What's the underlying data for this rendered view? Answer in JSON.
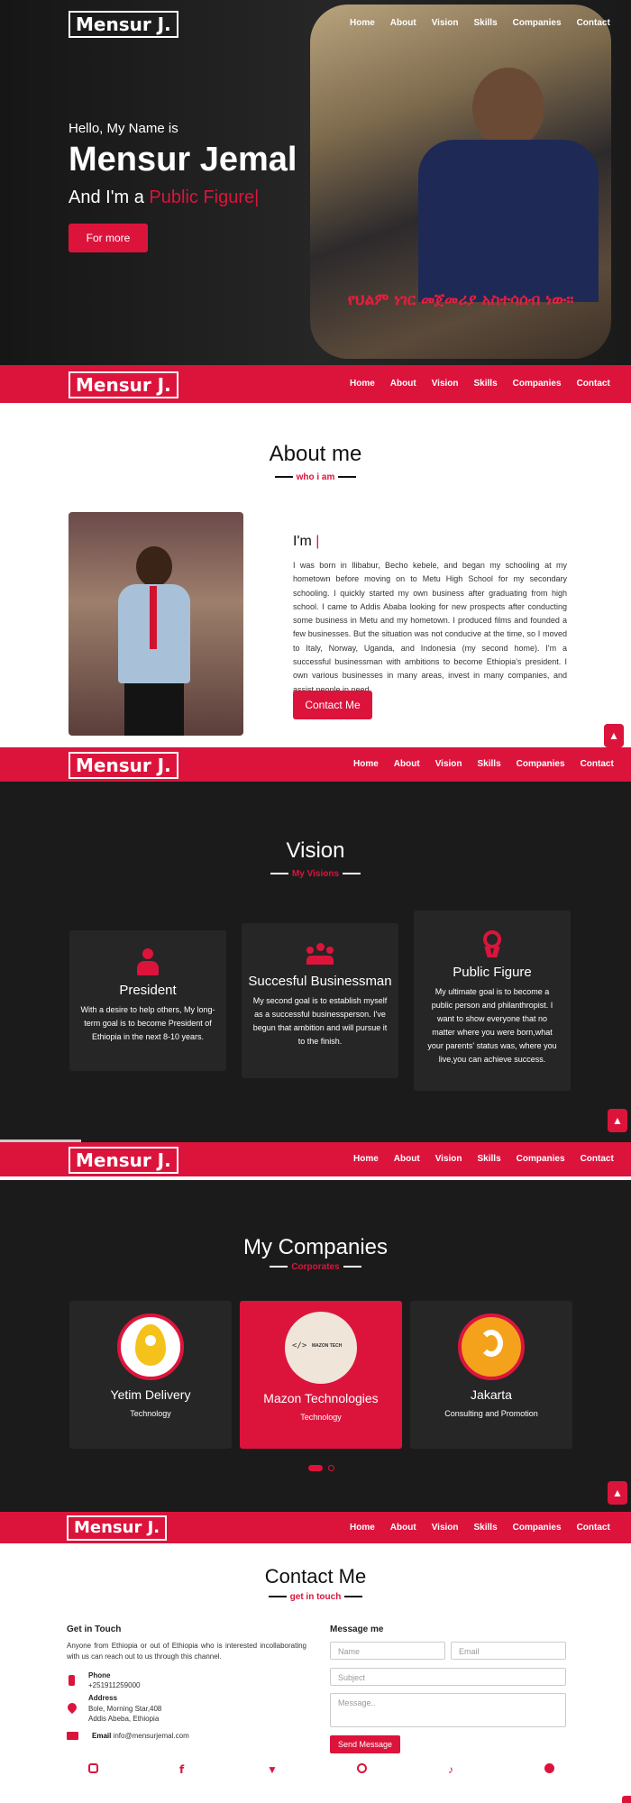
{
  "brand": "Mensur J.",
  "nav": [
    "Home",
    "About",
    "Vision",
    "Skills",
    "Companies",
    "Contact"
  ],
  "hero": {
    "greeting": "Hello, My Name is",
    "name": "Mensur Jemal",
    "prefix": "And I'm a ",
    "role": "Public Figure|",
    "button": "For more",
    "amharic": "የህልም ነገር መጀመሪያ አስተሳሰብ ነው።"
  },
  "about": {
    "title": "About me",
    "subtitle": "who i am",
    "im": "I'm",
    "cursor": "|",
    "body": "I was born in Ilibabur, Becho kebele, and began my schooling at my hometown before moving on to Metu High School for my secondary schooling. I quickly started my own business after graduating from high school. I came to Addis Ababa looking for new prospects after conducting some business in Metu and my hometown. I produced films and founded a few businesses. But the situation was not conducive at the time, so I moved to Italy, Norway, Uganda, and Indonesia (my second home). I'm a successful businessman with ambitions to become Ethiopia's president. I own various businesses in many areas, invest in many companies, and assist people in need.",
    "button": "Contact Me"
  },
  "vision": {
    "title": "Vision",
    "subtitle": "My Visions",
    "cards": [
      {
        "icon": "president-icon",
        "title": "President",
        "text": "With a desire to help others, My long-term goal is to become President of Ethiopia in the next 8-10 years."
      },
      {
        "icon": "people-icon",
        "title": "Succesful Businessman",
        "text": "My second goal is to establish myself as a successful businessperson. I've begun that ambition and will pursue it to the finish."
      },
      {
        "icon": "medal-icon",
        "title": "Public Figure",
        "text": "My ultimate goal is to become a public person and philanthropist. I want to show everyone that no matter where you were born,what your parents' status was, where you live,you can achieve success."
      }
    ]
  },
  "companies": {
    "title": "My Companies",
    "subtitle": "Corporates",
    "items": [
      {
        "name": "Yetim Delivery",
        "category": "Technology",
        "logo_text": ""
      },
      {
        "name": "Mazon Technologies",
        "category": "Technology",
        "logo_text": "MAZON TECH"
      },
      {
        "name": "Jakarta",
        "category": "Consulting and Promotion",
        "logo_text": ""
      }
    ]
  },
  "contact": {
    "title": "Contact Me",
    "subtitle": "get in touch",
    "get_in_touch": "Get in Touch",
    "intro": "Anyone from Ethiopia or out of Ethiopia who is interested incollaborating with us can reach out to us through this channel.",
    "phone_label": "Phone",
    "phone": "+251911259000",
    "address_label": "Address",
    "address1": "Bole, Morning Star,408",
    "address2": "Addis Abeba, Ethiopia",
    "email_label": "Email",
    "email": "info@mensurjemal.com",
    "message_title": "Message me",
    "name_ph": "Name",
    "email_ph": "Email",
    "subject_ph": "Subject",
    "message_ph": "Message..",
    "send": "Send Message"
  },
  "colors": {
    "accent": "#dc143c",
    "dark": "#1b1b1b",
    "card": "#262626"
  }
}
